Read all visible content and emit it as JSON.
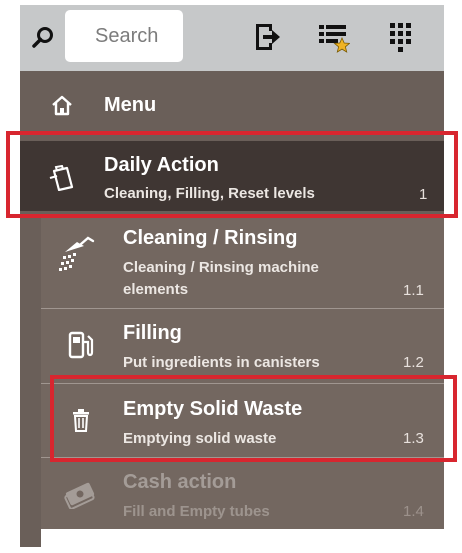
{
  "toolbar": {
    "search_placeholder": "Search",
    "icons": [
      "search-icon",
      "logout-icon",
      "favorites-list-icon",
      "keypad-icon"
    ]
  },
  "menu": {
    "header_label": "Menu",
    "items": [
      {
        "title": "Daily Action",
        "subtitle": "Cleaning, Filling, Reset levels",
        "number": "1",
        "icon": "clipboard-icon",
        "highlighted": true
      },
      {
        "title": "Cleaning / Rinsing",
        "subtitle": "Cleaning / Rinsing machine elements",
        "number": "1.1",
        "icon": "shower-icon"
      },
      {
        "title": "Filling",
        "subtitle": "Put ingredients in canisters",
        "number": "1.2",
        "icon": "fuel-icon"
      },
      {
        "title": "Empty Solid Waste",
        "subtitle": "Emptying solid waste",
        "number": "1.3",
        "icon": "trash-icon",
        "highlighted": true
      },
      {
        "title": "Cash action",
        "subtitle": "Fill and Empty tubes",
        "number": "1.4",
        "icon": "cash-icon",
        "disabled": true
      }
    ]
  },
  "colors": {
    "toolbar_bg": "#c6c8c9",
    "menu_bg": "#6a5f59",
    "active_item_bg": "#3f3633",
    "sub_item_bg": "#736760",
    "highlight_border": "#d8262f"
  }
}
